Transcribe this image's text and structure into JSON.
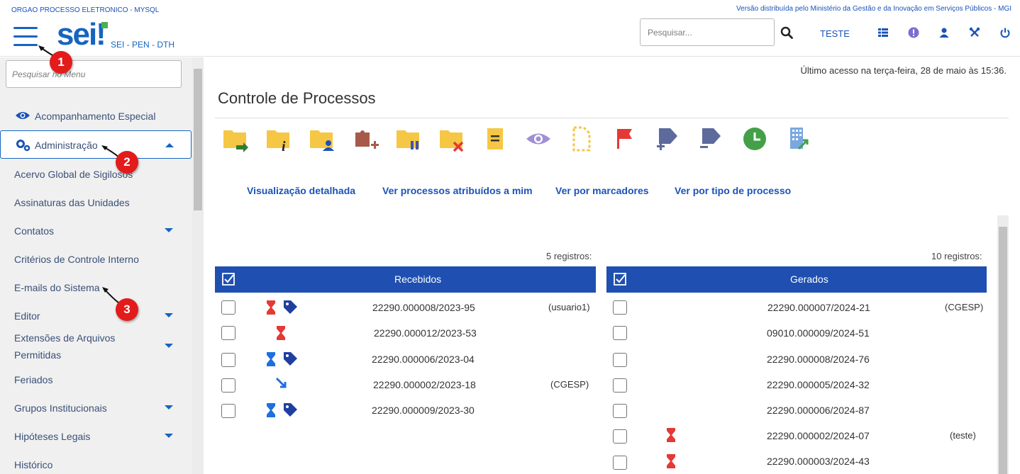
{
  "header": {
    "org_name": "ORGAO PROCESSO ELETRONICO - MYSQL",
    "gov_notice": "Versão distribuída pelo Ministério da Gestão e da Inovação em Serviços Públicos - MGI",
    "logo_text": "sei",
    "env_label": "SEI - PEN - DTH",
    "search_placeholder": "Pesquisar...",
    "unit_label": "TESTE",
    "icons": [
      "menu-icon",
      "search-icon",
      "grid-icon",
      "alert-icon",
      "user-icon",
      "tools-icon",
      "power-icon"
    ]
  },
  "callouts": {
    "c1": "1",
    "c2": "2",
    "c3": "3"
  },
  "sidebar": {
    "search_placeholder": "Pesquisar no Menu",
    "acompanhamento": "Acompanhamento Especial",
    "administracao": "Administração",
    "items": [
      "Acervo Global de Sigilosos",
      "Assinaturas das Unidades",
      "Contatos",
      "Critérios de Controle Interno",
      "E-mails do Sistema",
      "Editor",
      "Extensões de Arquivos",
      "Permitidas",
      "Feriados",
      "Grupos Institucionais",
      "Hipóteses Legais",
      "Histórico"
    ]
  },
  "main": {
    "last_access": "Último acesso na terça-feira, 28 de maio às 15:36.",
    "title": "Controle de Processos",
    "toolbar_icons": [
      "folder-send-icon",
      "folder-info-icon",
      "folder-user-icon",
      "puzzle-add-icon",
      "folder-pause-icon",
      "folder-close-icon",
      "note-icon",
      "eye-icon",
      "document-dashed-icon",
      "flag-icon",
      "tag-add-icon",
      "tag-remove-icon",
      "clock-icon",
      "building-icon"
    ],
    "views": [
      "Visualização detalhada",
      "Ver processos atribuídos a mim",
      "Ver por marcadores",
      "Ver por tipo de processo"
    ]
  },
  "recebidos": {
    "count": "5 registros:",
    "header": "Recebidos",
    "rows": [
      {
        "number": "22290.000008/2023-95",
        "note": "(usuario1)"
      },
      {
        "number": "22290.000012/2023-53",
        "note": ""
      },
      {
        "number": "22290.000006/2023-04",
        "note": ""
      },
      {
        "number": "22290.000002/2023-18",
        "note": "(CGESP)"
      },
      {
        "number": "22290.000009/2023-30",
        "note": ""
      }
    ]
  },
  "gerados": {
    "count": "10 registros:",
    "header": "Gerados",
    "rows": [
      {
        "number": "22290.000007/2024-21",
        "note": "(CGESP)"
      },
      {
        "number": "09010.000009/2024-51",
        "note": ""
      },
      {
        "number": "22290.000008/2024-76",
        "note": ""
      },
      {
        "number": "22290.000005/2024-32",
        "note": ""
      },
      {
        "number": "22290.000006/2024-87",
        "note": ""
      },
      {
        "number": "22290.000002/2024-07",
        "note": "(teste)"
      },
      {
        "number": "22290.000003/2024-43",
        "note": ""
      }
    ]
  },
  "colors": {
    "primary": "#1565c0",
    "header_blue": "#1f4fb0",
    "callout_red": "#e31b1b",
    "hourglass_red": "#e53935",
    "hourglass_blue": "#1e6fe0"
  }
}
